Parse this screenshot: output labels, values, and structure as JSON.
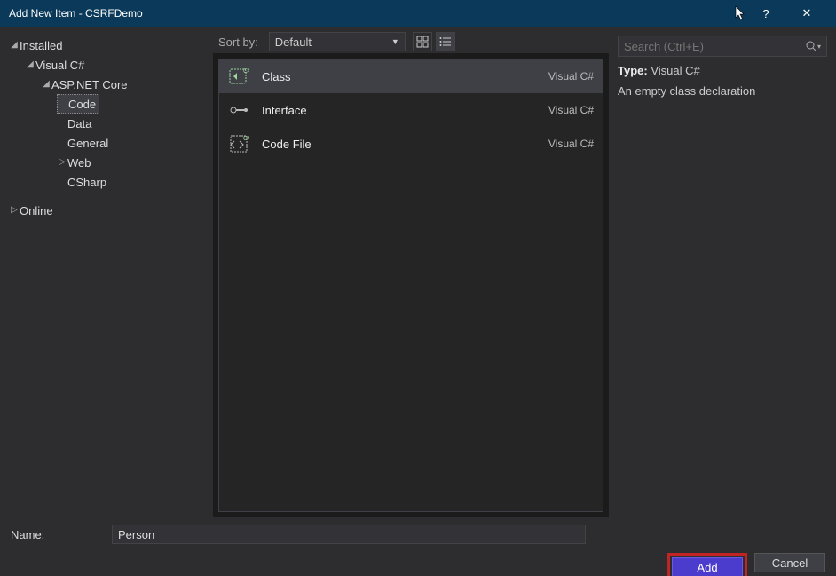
{
  "window": {
    "title": "Add New Item - CSRFDemo",
    "help": "?",
    "close": "✕"
  },
  "sidebar": {
    "root": [
      {
        "label": "Installed",
        "expanded": true,
        "children": [
          {
            "label": "Visual C#",
            "expanded": true,
            "children": [
              {
                "label": "ASP.NET Core",
                "expanded": true,
                "children": [
                  {
                    "label": "Code",
                    "selected": true
                  },
                  {
                    "label": "Data"
                  },
                  {
                    "label": "General"
                  },
                  {
                    "label": "Web",
                    "hasChildren": true
                  },
                  {
                    "label": "CSharp"
                  }
                ]
              }
            ]
          }
        ]
      },
      {
        "label": "Online",
        "expanded": false
      }
    ]
  },
  "toolbar": {
    "sort_label": "Sort by:",
    "sort_value": "Default"
  },
  "templates": [
    {
      "name": "Class",
      "lang": "Visual C#",
      "icon": "class",
      "selected": true
    },
    {
      "name": "Interface",
      "lang": "Visual C#",
      "icon": "interface"
    },
    {
      "name": "Code File",
      "lang": "Visual C#",
      "icon": "codefile"
    }
  ],
  "details": {
    "type_label": "Type:",
    "type_value": "Visual C#",
    "description": "An empty class declaration"
  },
  "search": {
    "placeholder": "Search (Ctrl+E)"
  },
  "footer": {
    "name_label": "Name:",
    "name_value": "Person",
    "add": "Add",
    "cancel": "Cancel"
  }
}
